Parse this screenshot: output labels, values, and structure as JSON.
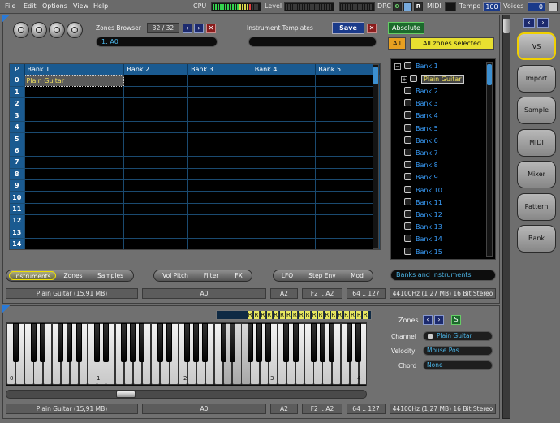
{
  "menu": [
    "File",
    "Edit",
    "Options",
    "View",
    "Help"
  ],
  "status": {
    "cpu_label": "CPU",
    "level_label": "Level",
    "drc_label": "DRC",
    "o_label": "O",
    "r_label": "R",
    "midi_label": "MIDI",
    "tempo_label": "Tempo",
    "tempo_value": "100",
    "voices_label": "Voices",
    "voices_value": "0",
    "cpu_level": 0.85
  },
  "toolbar": {
    "zones_browser_label": "Zones Browser",
    "zone_counter": "32 / 32",
    "zone_field": "1: A0",
    "instrument_templates_label": "Instrument Templates",
    "save_label": "Save",
    "absolute_label": "Absolute",
    "all_label": "All",
    "all_zones_selected": "All zones selected",
    "icon_names": [
      "open-folder-icon",
      "save-disk-icon",
      "waveform-icon",
      "record-icon"
    ]
  },
  "grid": {
    "p_header": "P",
    "columns": [
      "Bank 1",
      "Bank 2",
      "Bank 3",
      "Bank 4",
      "Bank 5"
    ],
    "rows": [
      "0",
      "1",
      "2",
      "3",
      "4",
      "5",
      "6",
      "7",
      "8",
      "9",
      "10",
      "11",
      "12",
      "13",
      "14"
    ],
    "cell_0_bank1": "Plain Guitar"
  },
  "tree": {
    "root": "Bank 1",
    "child": "Plain Guitar",
    "items": [
      "Bank 2",
      "Bank 3",
      "Bank 4",
      "Bank 5",
      "Bank 6",
      "Bank 7",
      "Bank 8",
      "Bank 9",
      "Bank 10",
      "Bank 11",
      "Bank 12",
      "Bank 13",
      "Bank 14",
      "Bank 15"
    ]
  },
  "tabs_group1": [
    "Instruments",
    "Zones",
    "Samples"
  ],
  "tabs_group2": [
    "Vol Pitch",
    "Filter",
    "FX"
  ],
  "tabs_group3": [
    "LFO",
    "Step Env",
    "Mod"
  ],
  "banks_dropdown": "Banks and Instruments",
  "statusbar": {
    "instrument": "Plain Guitar (15,91 MB)",
    "zone": "A0",
    "root": "A2",
    "key_range": "F2 .. A2",
    "vel_range": "64 .. 127",
    "format": "44100Hz (1,27 MB) 16 Bit Stereo"
  },
  "sidebar": [
    "VS",
    "Import",
    "Sample",
    "MIDI",
    "Mixer",
    "Pattern",
    "Bank"
  ],
  "keyboard": {
    "octave_labels": [
      "0",
      "1",
      "2",
      "3",
      "4"
    ],
    "rk_letters": [
      "R",
      "R",
      "R",
      "R",
      "R",
      "R",
      "R",
      "R",
      "R",
      "R",
      "R",
      "R",
      "R",
      "R",
      "R",
      "R",
      "R",
      "R",
      "R"
    ]
  },
  "zones_panel": {
    "zones_label": "Zones",
    "s_label": "S",
    "channel_label": "Channel",
    "channel_value": "Plain Guitar",
    "velocity_label": "Velocity",
    "velocity_value": "Mouse Pos",
    "chord_label": "Chord",
    "chord_value": "None"
  },
  "colors": {
    "accent_yellow": "#f0d000",
    "grid_blue": "#1a5a90",
    "text_blue": "#3aa0ff"
  }
}
